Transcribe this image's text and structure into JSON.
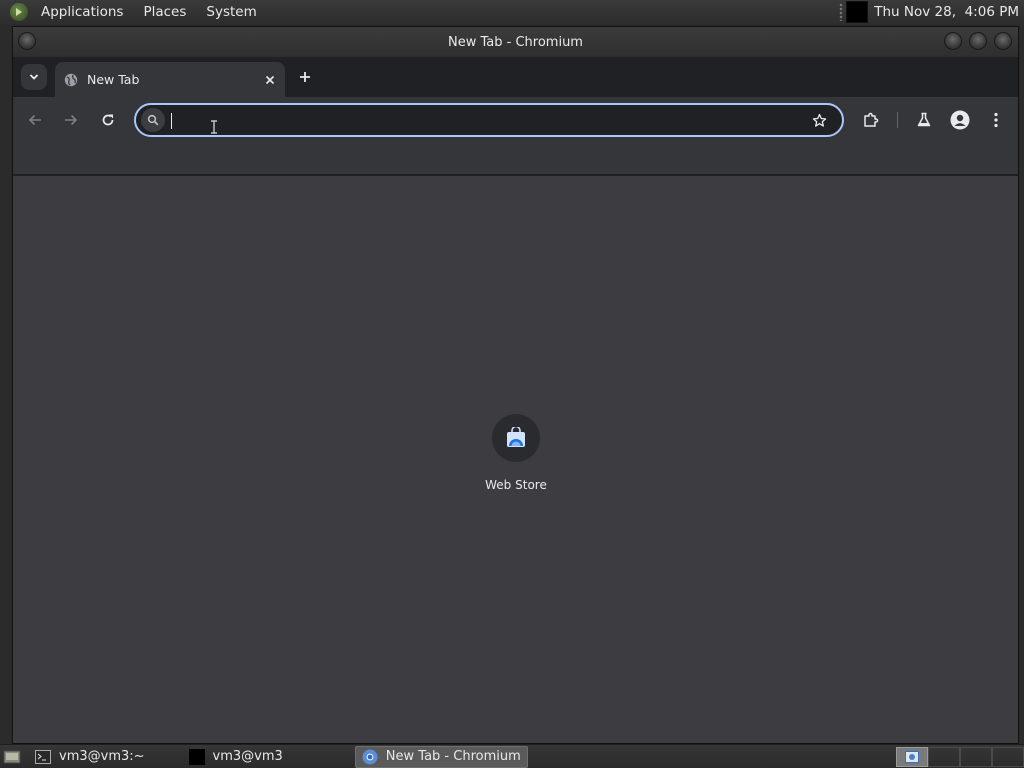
{
  "top_panel": {
    "menus": [
      "Applications",
      "Places",
      "System"
    ],
    "clock": "Thu Nov 28,  4:06 PM"
  },
  "window": {
    "title": "New Tab - Chromium"
  },
  "tabs": [
    {
      "title": "New Tab",
      "favicon": "globe-icon",
      "active": true
    }
  ],
  "omnibox": {
    "value": "",
    "placeholder": ""
  },
  "toolbar": {
    "back_icon": "arrow-left-icon",
    "forward_icon": "arrow-right-icon",
    "reload_icon": "reload-icon",
    "bookmark_icon": "star-icon",
    "extensions_icon": "puzzle-icon",
    "labs_icon": "flask-icon",
    "profile_icon": "person-icon",
    "menu_icon": "kebab-menu-icon"
  },
  "content": {
    "shortcuts": [
      {
        "label": "Web Store",
        "icon": "web-store-icon"
      }
    ]
  },
  "taskbar": {
    "tasks": [
      {
        "label": "vm3@vm3:~",
        "icon": "terminal-icon",
        "active": false
      },
      {
        "label": "vm3@vm3",
        "icon": "black-window-icon",
        "active": false
      },
      {
        "label": "New Tab - Chromium",
        "icon": "chromium-icon",
        "active": true
      }
    ]
  },
  "colors": {
    "omnibox_focus": "#a8c7fa",
    "content_bg": "#3c3c41",
    "toolbar_bg": "#35363a"
  }
}
